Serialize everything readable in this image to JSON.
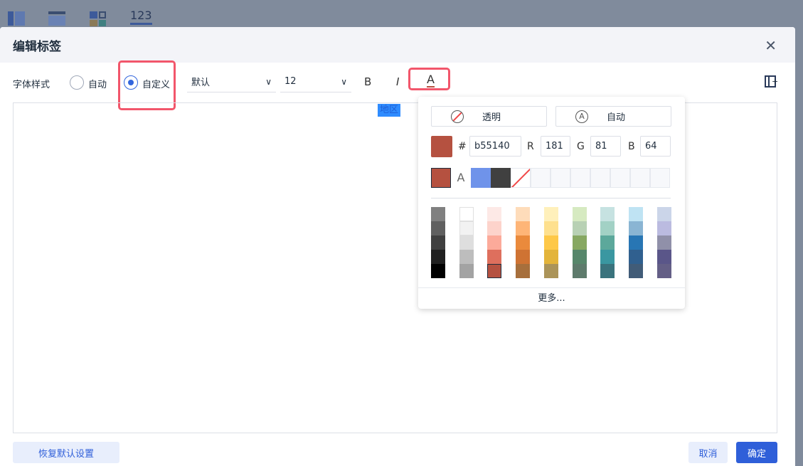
{
  "background": {
    "toolbar_number_icon": "123"
  },
  "dialog": {
    "title": "编辑标签",
    "font_style_label": "字体样式",
    "radio_auto": "自动",
    "radio_custom": "自定义",
    "font_family": "默认",
    "font_size": "12",
    "bold_icon": "B",
    "italic_icon": "I",
    "color_icon": "A",
    "editor_tag": "地区",
    "reset_button": "恢复默认设置",
    "cancel_button": "取消",
    "confirm_button": "确定"
  },
  "color_picker": {
    "transparent_label": "透明",
    "auto_label": "自动",
    "hash": "#",
    "hex": "b55140",
    "r_label": "R",
    "r": "181",
    "g_label": "G",
    "g": "81",
    "b_label": "B",
    "b": "64",
    "current_color": "#b55140",
    "recent_auto_glyph": "A",
    "recent": [
      "#b55140",
      "auto",
      "#6f93ea",
      "#404040",
      "none"
    ],
    "palette": [
      [
        "#808080",
        "#606060",
        "#404040",
        "#202020",
        "#000000"
      ],
      [
        "#ffffff",
        "#f2f2f2",
        "#dedede",
        "#bdbdbd",
        "#a3a3a3"
      ],
      [
        "#fde9e6",
        "#fdd3cb",
        "#fcaa9a",
        "#de6f5d",
        "#b55140"
      ],
      [
        "#fedcba",
        "#feb577",
        "#ea8a3c",
        "#cf7333",
        "#a76f3c"
      ],
      [
        "#fff0bb",
        "#fee08e",
        "#fec848",
        "#e3b43a",
        "#ab9459"
      ],
      [
        "#d6eac1",
        "#b8d1b4",
        "#87a862",
        "#57876b",
        "#5e7b6c"
      ],
      [
        "#c6e2e1",
        "#a2d1c5",
        "#5ca89b",
        "#3a97a1",
        "#3a737d"
      ],
      [
        "#bfe3f3",
        "#8ab5d3",
        "#2876b4",
        "#30608f",
        "#415c78"
      ],
      [
        "#cbd5e9",
        "#bbbbe0",
        "#9090a9",
        "#5a5689",
        "#645f86"
      ]
    ],
    "more": "更多..."
  },
  "colors": {
    "accent": "#2f5fd9",
    "highlight": "#f2566b"
  }
}
